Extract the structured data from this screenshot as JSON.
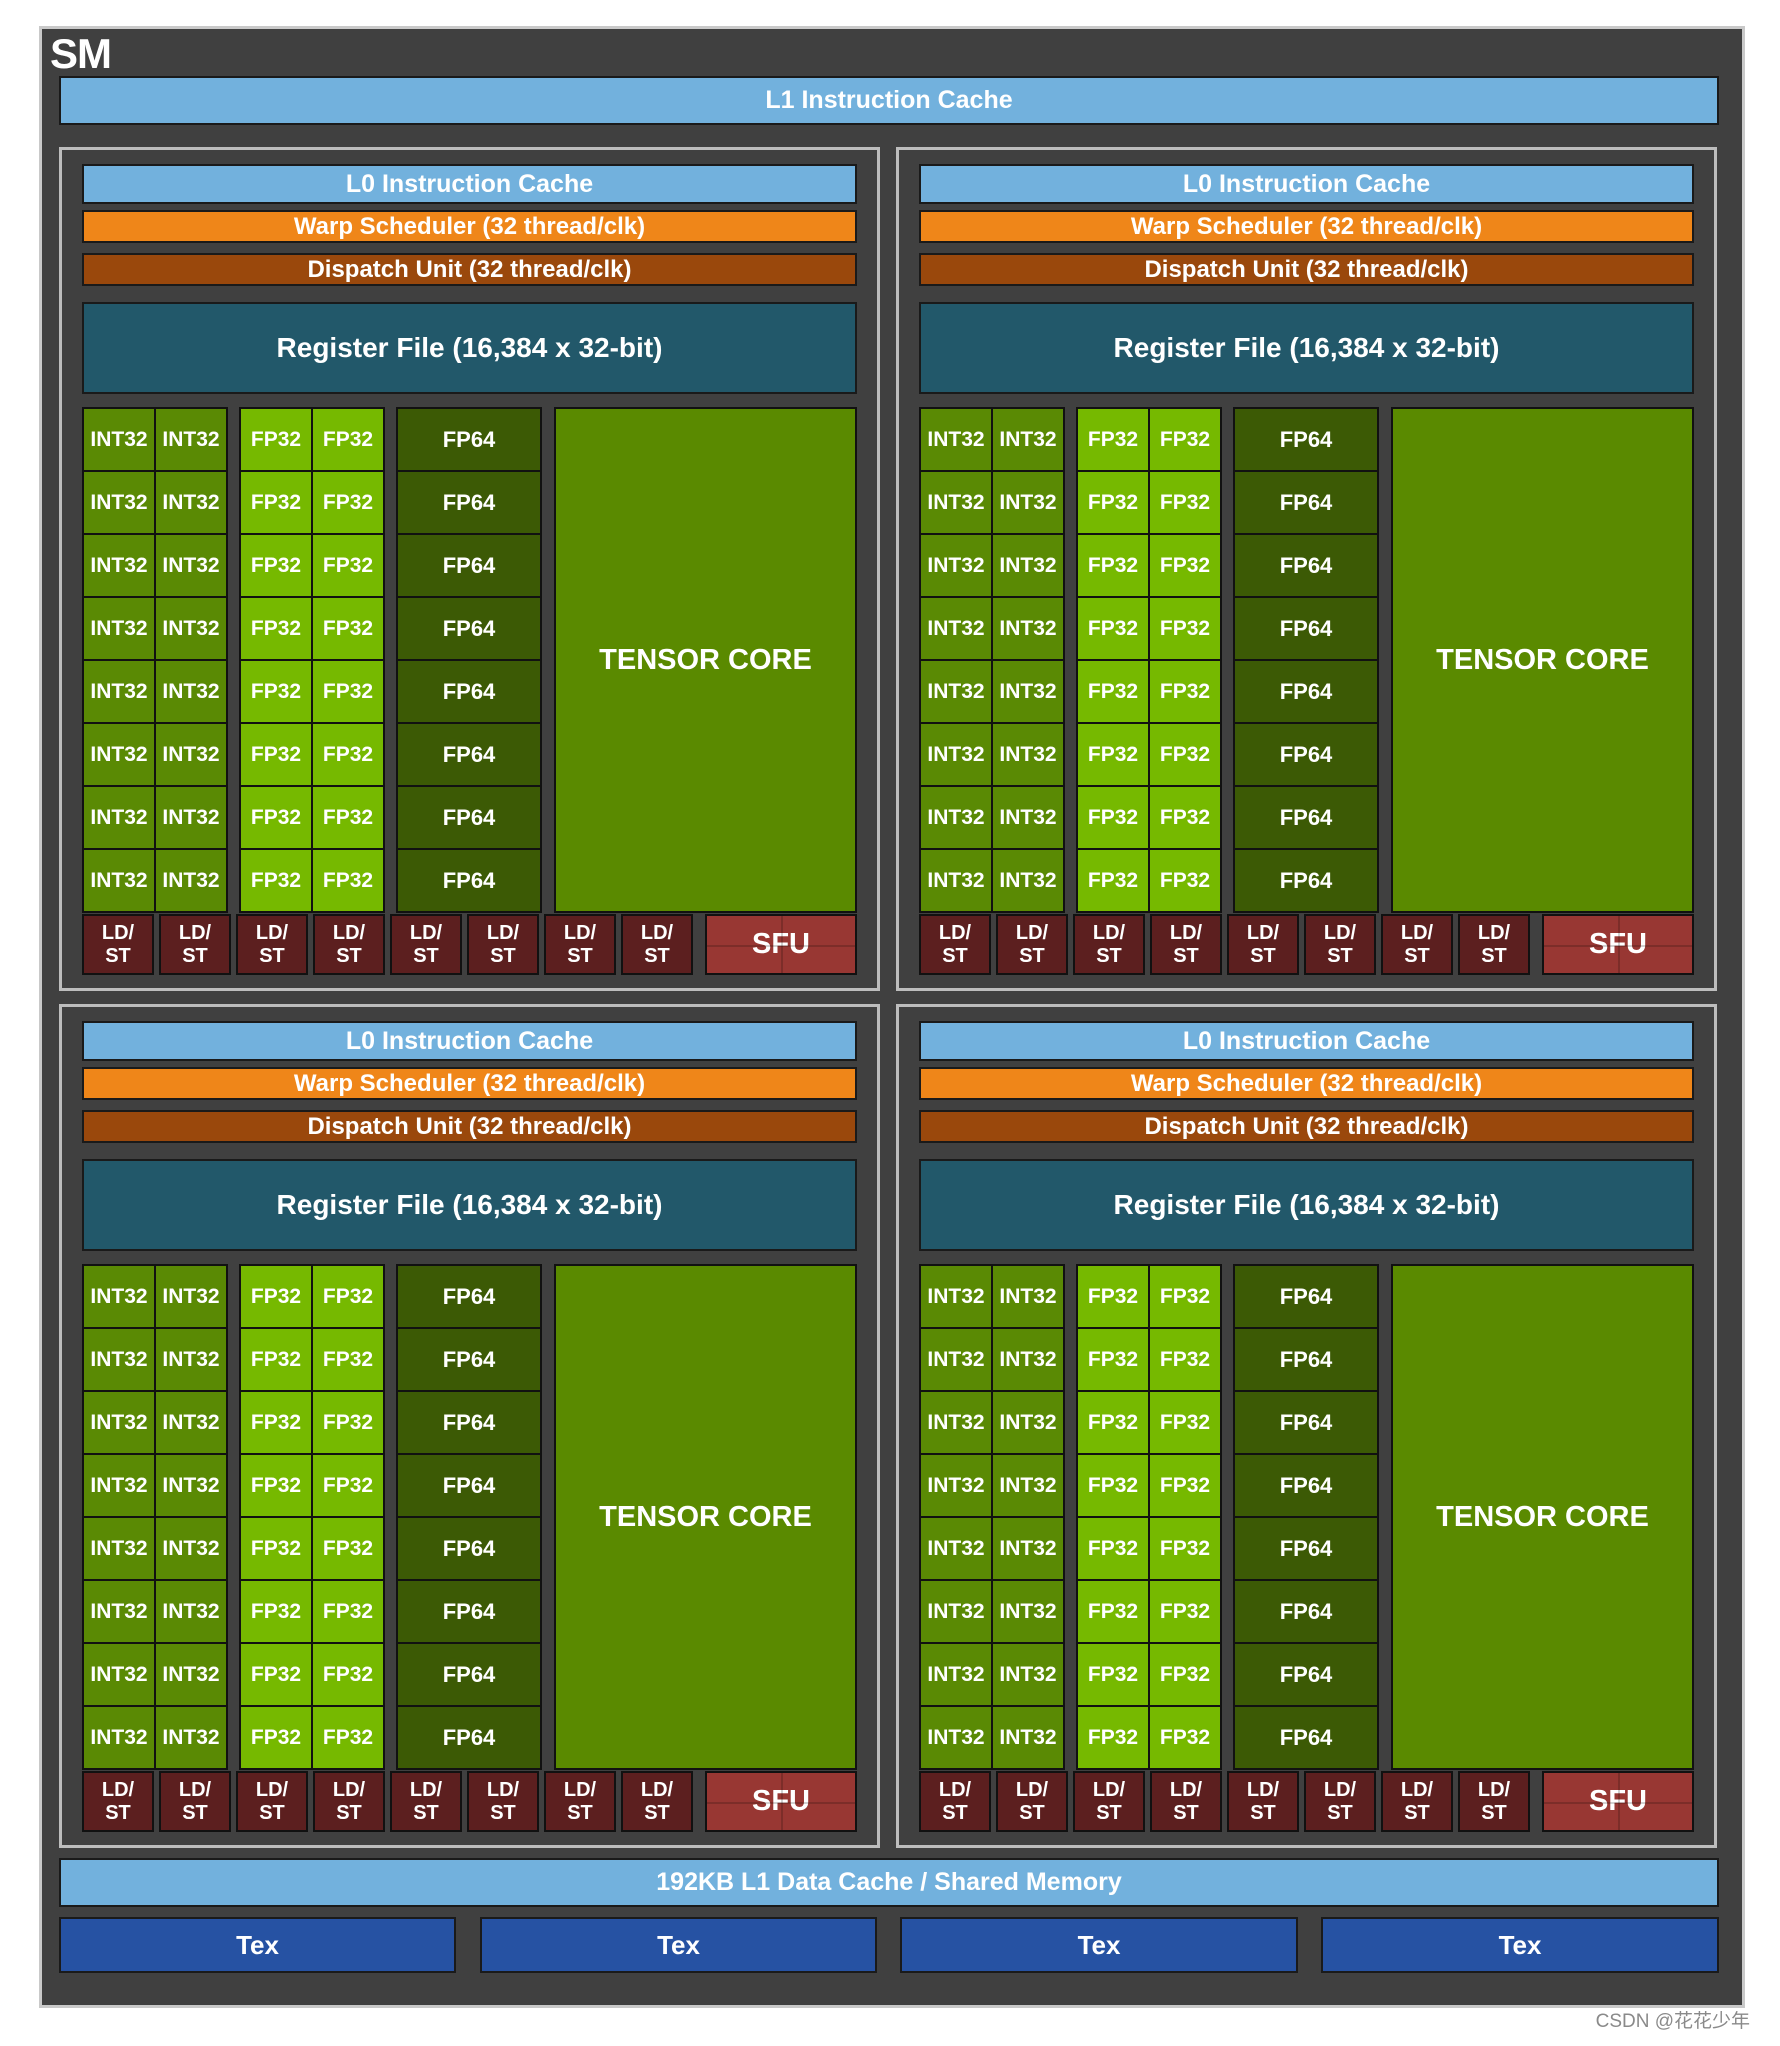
{
  "sm": {
    "title": "SM",
    "l1_instruction_cache": "L1 Instruction Cache",
    "partitions": [
      {
        "id": "top-left"
      },
      {
        "id": "top-right"
      },
      {
        "id": "bottom-left"
      },
      {
        "id": "bottom-right"
      }
    ],
    "partition_template": {
      "l0_instruction_cache": "L0 Instruction Cache",
      "warp_scheduler": "Warp Scheduler (32 thread/clk)",
      "dispatch_unit": "Dispatch Unit (32 thread/clk)",
      "register_file": "Register File (16,384 x 32-bit)",
      "int32_label": "INT32",
      "fp32_label": "FP32",
      "fp64_label": "FP64",
      "tensor_core_label": "TENSOR CORE",
      "ldst_label_line1": "LD/",
      "ldst_label_line2": "ST",
      "sfu_label": "SFU",
      "rows": 8,
      "int32_per_row": 2,
      "fp32_per_row": 2,
      "fp64_per_row": 1,
      "ldst_units": 8
    },
    "l1_data_cache": "192KB L1 Data Cache / Shared Memory",
    "tex_units": [
      "Tex",
      "Tex",
      "Tex",
      "Tex"
    ]
  },
  "colors": {
    "sm_background": "#404040",
    "cache": "#72b1dd",
    "warp_scheduler": "#ef8619",
    "dispatch_unit": "#9a480c",
    "register_file": "#22586a",
    "int32": "#5a8a04",
    "fp32": "#76b900",
    "fp64": "#3c5a05",
    "tensor_core": "#5a8a00",
    "ldst": "#5c1f1f",
    "sfu": "#983733",
    "tex": "#2652a3"
  },
  "watermark": "CSDN @花花少年"
}
